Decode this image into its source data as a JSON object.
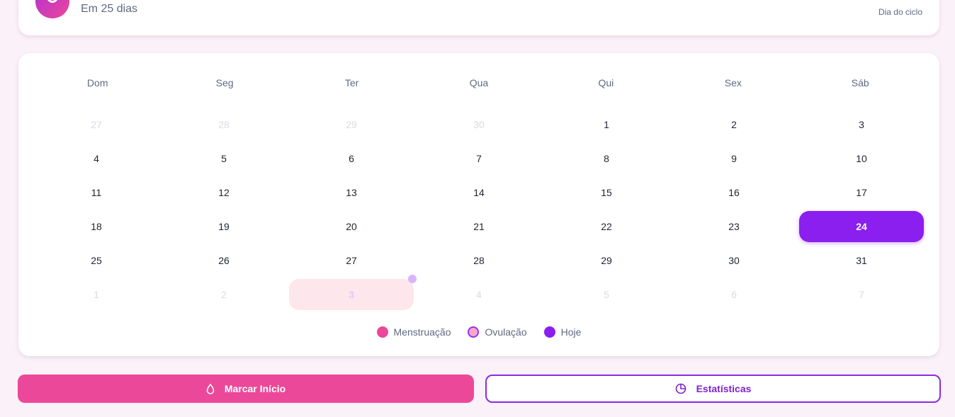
{
  "summary": {
    "next_period": "Em 25 dias",
    "cycle_day_label": "Dia do ciclo"
  },
  "calendar": {
    "weekdays": [
      "Dom",
      "Seg",
      "Ter",
      "Qua",
      "Qui",
      "Sex",
      "Sáb"
    ],
    "days": [
      {
        "label": "27",
        "state": "muted"
      },
      {
        "label": "28",
        "state": "muted"
      },
      {
        "label": "29",
        "state": "muted"
      },
      {
        "label": "30",
        "state": "muted"
      },
      {
        "label": "1",
        "state": "normal"
      },
      {
        "label": "2",
        "state": "normal"
      },
      {
        "label": "3",
        "state": "normal"
      },
      {
        "label": "4",
        "state": "normal"
      },
      {
        "label": "5",
        "state": "normal"
      },
      {
        "label": "6",
        "state": "normal"
      },
      {
        "label": "7",
        "state": "normal"
      },
      {
        "label": "8",
        "state": "normal"
      },
      {
        "label": "9",
        "state": "normal"
      },
      {
        "label": "10",
        "state": "normal"
      },
      {
        "label": "11",
        "state": "normal"
      },
      {
        "label": "12",
        "state": "normal"
      },
      {
        "label": "13",
        "state": "normal"
      },
      {
        "label": "14",
        "state": "normal"
      },
      {
        "label": "15",
        "state": "normal"
      },
      {
        "label": "16",
        "state": "normal"
      },
      {
        "label": "17",
        "state": "normal"
      },
      {
        "label": "18",
        "state": "normal"
      },
      {
        "label": "19",
        "state": "normal"
      },
      {
        "label": "20",
        "state": "normal"
      },
      {
        "label": "21",
        "state": "normal"
      },
      {
        "label": "22",
        "state": "normal"
      },
      {
        "label": "23",
        "state": "normal"
      },
      {
        "label": "24",
        "state": "today"
      },
      {
        "label": "25",
        "state": "normal"
      },
      {
        "label": "26",
        "state": "normal"
      },
      {
        "label": "27",
        "state": "normal"
      },
      {
        "label": "28",
        "state": "normal"
      },
      {
        "label": "29",
        "state": "normal"
      },
      {
        "label": "30",
        "state": "normal"
      },
      {
        "label": "31",
        "state": "normal"
      },
      {
        "label": "1",
        "state": "muted"
      },
      {
        "label": "2",
        "state": "muted"
      },
      {
        "label": "3",
        "state": "fertile"
      },
      {
        "label": "4",
        "state": "muted"
      },
      {
        "label": "5",
        "state": "muted"
      },
      {
        "label": "6",
        "state": "muted"
      },
      {
        "label": "7",
        "state": "muted"
      }
    ],
    "legend": [
      {
        "label": "Menstruação",
        "color": "#ec4899",
        "style": "filled"
      },
      {
        "label": "Ovulação",
        "color": "#f7a8c8",
        "border": "#9333ea",
        "style": "ringed"
      },
      {
        "label": "Hoje",
        "color": "#8a1ff0",
        "style": "filled"
      }
    ]
  },
  "actions": {
    "start_label": "Marcar Início",
    "start_icon": "drop-icon",
    "stats_label": "Estatísticas",
    "stats_icon": "pie-chart-icon"
  },
  "colors": {
    "accent_purple": "#8a1ff0",
    "accent_pink": "#ec4899",
    "background": "#fbf1f8"
  }
}
